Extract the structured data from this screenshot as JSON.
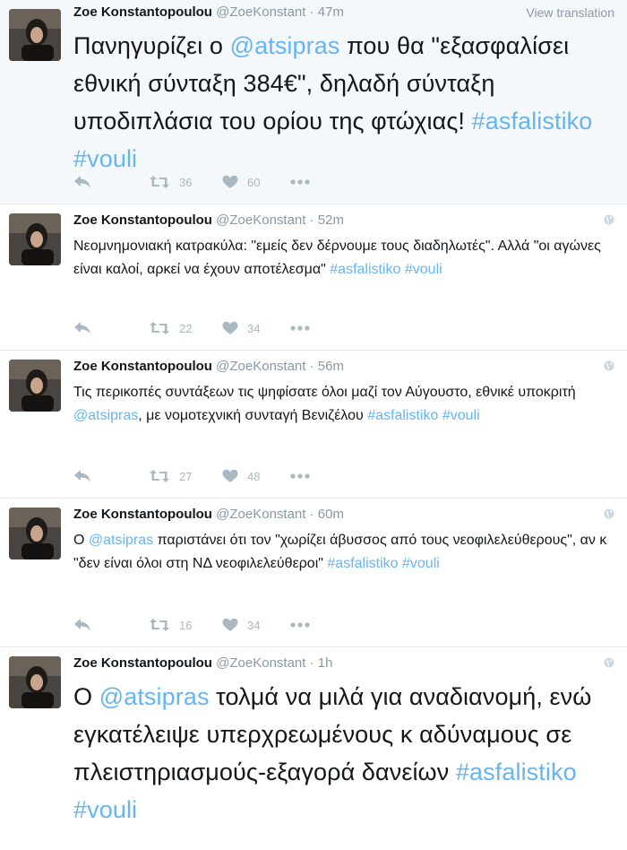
{
  "colors": {
    "link": "#66b5f3",
    "muted": "#8899a6",
    "icon": "#aab8c2",
    "highlight_bg": "#f5f8fa"
  },
  "icons": {
    "reply": "reply-icon",
    "retweet": "retweet-icon",
    "like": "heart-icon",
    "more": "more-icon",
    "globe": "globe-icon"
  },
  "tweets": [
    {
      "fullname": "Zoe Konstantopoulou",
      "username": "@ZoeKonstant",
      "sep": "·",
      "time": "47m",
      "view_translation": "View translation",
      "text": [
        {
          "t": "Πανηγυρίζει ο "
        },
        {
          "t": "@atsipras",
          "link": true
        },
        {
          "t": " που θα \"εξασφαλίσει εθνική σύνταξη 384€\", δηλαδή σύνταξη υποδιπλάσια του ορίου της φτώχιας! "
        },
        {
          "t": "#asfalistiko",
          "link": true
        },
        {
          "t": " "
        },
        {
          "t": "#vouli",
          "link": true
        }
      ],
      "retweets": "36",
      "likes": "60"
    },
    {
      "fullname": "Zoe Konstantopoulou",
      "username": "@ZoeKonstant",
      "sep": "·",
      "time": "52m",
      "text": [
        {
          "t": "Νεομνημονιακή κατρακύλα: \"εμείς δεν δέρνουμε τους διαδηλωτές\". Αλλά \"οι αγώνες είναι καλοί, αρκεί να έχουν αποτέλεσμα\" "
        },
        {
          "t": "#asfalistiko",
          "link": true
        },
        {
          "t": " "
        },
        {
          "t": "#vouli",
          "link": true
        }
      ],
      "retweets": "22",
      "likes": "34"
    },
    {
      "fullname": "Zoe Konstantopoulou",
      "username": "@ZoeKonstant",
      "sep": "·",
      "time": "56m",
      "text": [
        {
          "t": "Τις περικοπές συντάξεων τις ψηφίσατε όλοι μαζί τον Αύγουστο, εθνικέ υποκριτή "
        },
        {
          "t": "@atsipras",
          "link": true
        },
        {
          "t": ", με νομοτεχνική συνταγή Βενιζέλου "
        },
        {
          "t": "#asfalistiko",
          "link": true
        },
        {
          "t": " "
        },
        {
          "t": "#vouli",
          "link": true
        }
      ],
      "retweets": "27",
      "likes": "48"
    },
    {
      "fullname": "Zoe Konstantopoulou",
      "username": "@ZoeKonstant",
      "sep": "·",
      "time": "60m",
      "text": [
        {
          "t": "Ο "
        },
        {
          "t": "@atsipras",
          "link": true
        },
        {
          "t": " παριστάνει ότι τον \"χωρίζει άβυσσος από τους νεοφιλελεύθερους\", αν κ \"δεν είναι όλοι στη ΝΔ νεοφιλελεύθεροι\" "
        },
        {
          "t": "#asfalistiko",
          "link": true
        },
        {
          "t": " "
        },
        {
          "t": "#vouli",
          "link": true
        }
      ],
      "retweets": "16",
      "likes": "34"
    },
    {
      "fullname": "Zoe Konstantopoulou",
      "username": "@ZoeKonstant",
      "sep": "·",
      "time": "1h",
      "text": [
        {
          "t": "Ο "
        },
        {
          "t": "@atsipras",
          "link": true
        },
        {
          "t": " τολμά να μιλά για αναδιανομή, ενώ εγκατέλειψε υπερχρεωμένους κ αδύναμους σε πλειστηριασμούς-εξαγορά δανείων "
        },
        {
          "t": "#asfalistiko",
          "link": true
        },
        {
          "t": " "
        },
        {
          "t": "#vouli",
          "link": true
        }
      ],
      "retweets": "",
      "likes": ""
    }
  ]
}
